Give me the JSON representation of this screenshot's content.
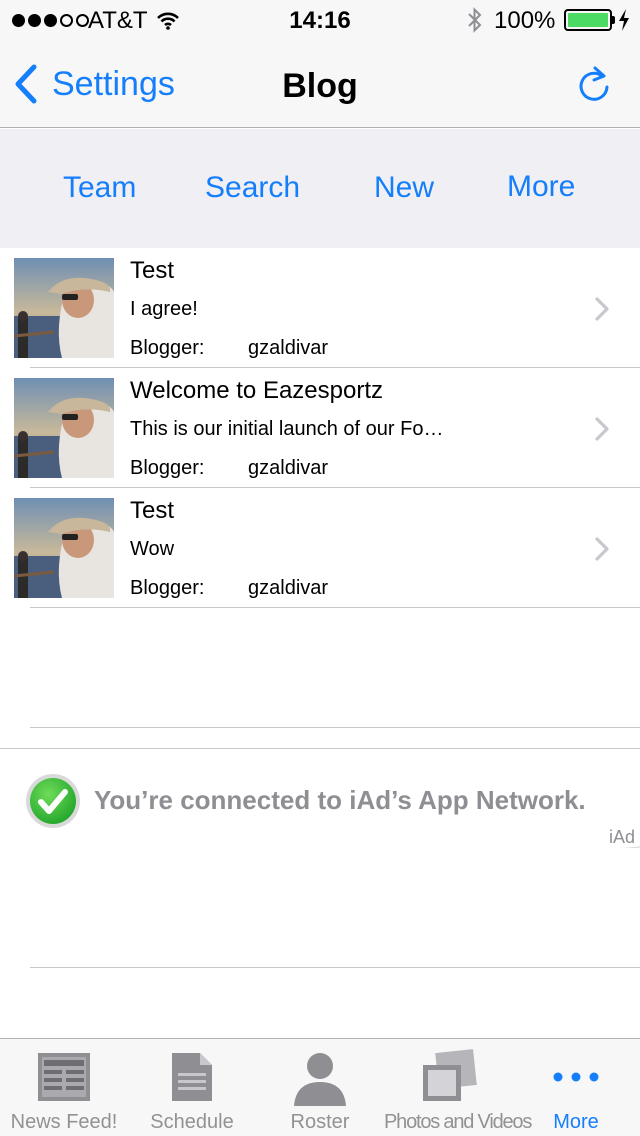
{
  "status_bar": {
    "carrier": "AT&T",
    "time": "14:16",
    "battery_percent": "100%",
    "signal_bars": 3
  },
  "nav": {
    "back_label": "Settings",
    "title": "Blog",
    "refresh_icon": "refresh-icon"
  },
  "toolbar": {
    "items": [
      {
        "label": "Team"
      },
      {
        "label": "Search"
      },
      {
        "label": "New"
      },
      {
        "label": "More"
      }
    ]
  },
  "posts": [
    {
      "title": "Test",
      "summary": "I agree!",
      "blogger_label": "Blogger:",
      "blogger": "gzaldivar"
    },
    {
      "title": "Welcome to Eazesportz",
      "summary": "This is our initial launch of our Fo…",
      "blogger_label": "Blogger:",
      "blogger": "gzaldivar"
    },
    {
      "title": "Test",
      "summary": "Wow",
      "blogger_label": "Blogger:",
      "blogger": "gzaldivar"
    }
  ],
  "ad": {
    "message": "You’re connected to iAd’s App Network.",
    "label": "iAd"
  },
  "tabs": [
    {
      "label": "News Feed!",
      "icon": "newspaper-icon",
      "active": false
    },
    {
      "label": "Schedule",
      "icon": "document-icon",
      "active": false
    },
    {
      "label": "Roster",
      "icon": "person-icon",
      "active": false
    },
    {
      "label": "Photos and Videos",
      "icon": "photos-icon",
      "active": false
    },
    {
      "label": "More",
      "icon": "more-dots-icon",
      "active": true
    }
  ],
  "colors": {
    "accent": "#157efb",
    "battery": "#4cd964",
    "inactive_tab": "#929292"
  }
}
